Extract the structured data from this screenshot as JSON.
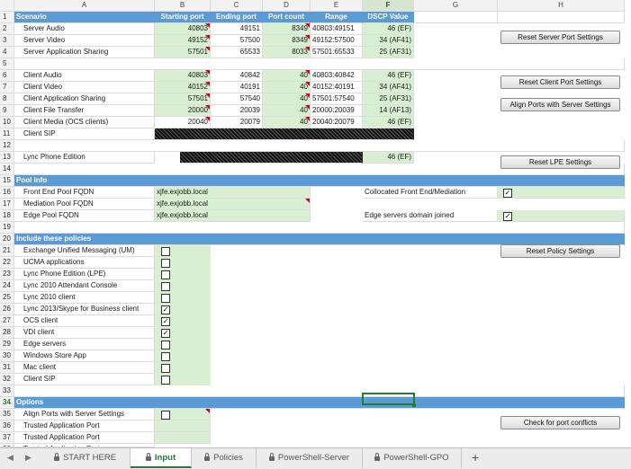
{
  "columns": [
    "A",
    "B",
    "C",
    "D",
    "E",
    "F",
    "G",
    "H"
  ],
  "sheet_headers": {
    "scenario": "Scenario",
    "starting_port": "Starting port",
    "ending_port": "Ending port",
    "port_count": "Port count",
    "range": "Range",
    "dscp_value": "DSCP Value"
  },
  "rows": {
    "r2": {
      "num": "2",
      "label": "Server Audio",
      "start": "40803",
      "end": "49151",
      "count": "8349",
      "range": "40803:49151",
      "dscp": "46 (EF)"
    },
    "r3": {
      "num": "3",
      "label": "Server Video",
      "start": "49152",
      "end": "57500",
      "count": "8349",
      "range": "49152:57500",
      "dscp": "34 (AF41)"
    },
    "r4": {
      "num": "4",
      "label": "Server Application Sharing",
      "start": "57501",
      "end": "65533",
      "count": "8033",
      "range": "57501:65533",
      "dscp": "25 (AF31)"
    },
    "r6": {
      "num": "6",
      "label": "Client Audio",
      "start": "40803",
      "end": "40842",
      "count": "40",
      "range": "40803:40842",
      "dscp": "46 (EF)"
    },
    "r7": {
      "num": "7",
      "label": "Client Video",
      "start": "40152",
      "end": "40191",
      "count": "40",
      "range": "40152:40191",
      "dscp": "34 (AF41)"
    },
    "r8": {
      "num": "8",
      "label": "Client Application Sharing",
      "start": "57501",
      "end": "57540",
      "count": "40",
      "range": "57501:57540",
      "dscp": "25 (AF31)"
    },
    "r9": {
      "num": "9",
      "label": "Client File Transfer",
      "start": "20000",
      "end": "20039",
      "count": "40",
      "range": "20000:20039",
      "dscp": "14 (AF13)"
    },
    "r10": {
      "num": "10",
      "label": "Client Media (OCS clients)",
      "start": "20040",
      "end": "20079",
      "count": "40",
      "range": "20040:20079",
      "dscp": "46 (EF)"
    },
    "r11": {
      "num": "11",
      "label": "Client SIP"
    },
    "r13": {
      "num": "13",
      "label": "Lync Phone Edition",
      "dscp": "46 (EF)"
    }
  },
  "row_numbers": {
    "r1": "1",
    "r5": "5",
    "r12": "12",
    "r14": "14",
    "r15": "15",
    "r16": "16",
    "r17": "17",
    "r18": "18",
    "r19": "19",
    "r20": "20",
    "r21": "21",
    "r22": "22",
    "r23": "23",
    "r24": "24",
    "r25": "25",
    "r26": "26",
    "r27": "27",
    "r28": "28",
    "r29": "29",
    "r30": "30",
    "r31": "31",
    "r32": "32",
    "r33": "33",
    "r34": "34",
    "r35": "35",
    "r36": "36",
    "r37": "37",
    "r38": "38"
  },
  "pool_info": {
    "section": "Pool info",
    "front_end_label": "Front End Pool FQDN",
    "front_end_value": "xjfe.exjobb.local",
    "mediation_label": "Mediation Pool FQDN",
    "mediation_value": "xjfe.exjobb.local",
    "edge_label": "Edge Pool FQDN",
    "edge_value": "xjfe.exjobb.local",
    "collocated_label": "Collocated Front End/Mediation",
    "collocated_checked": "✓",
    "edge_domain_label": "Edge servers domain joined",
    "edge_domain_checked": "✓"
  },
  "policies": {
    "section": "Include these policies",
    "items": [
      {
        "label": "Exchange Unified Messaging (UM)",
        "mark": ""
      },
      {
        "label": "UCMA applications",
        "mark": ""
      },
      {
        "label": "Lync Phone Edition (LPE)",
        "mark": ""
      },
      {
        "label": "Lync 2010 Attendant Console",
        "mark": ""
      },
      {
        "label": "Lync 2010 client",
        "mark": ""
      },
      {
        "label": "Lync 2013/Skype for Business client",
        "mark": "✓"
      },
      {
        "label": "OCS client",
        "mark": "✓"
      },
      {
        "label": "VDI client",
        "mark": "✓"
      },
      {
        "label": "Edge servers",
        "mark": ""
      },
      {
        "label": "Windows Store App",
        "mark": ""
      },
      {
        "label": "Mac client",
        "mark": ""
      },
      {
        "label": "Client SIP",
        "mark": ""
      }
    ]
  },
  "options": {
    "section": "Options",
    "items": [
      "Align Ports with Server Settings",
      "Trusted Application Port",
      "Trusted Application Port",
      "Trusted Application Port"
    ]
  },
  "buttons": {
    "reset_server": "Reset Server Port Settings",
    "reset_client": "Reset Client Port Settings",
    "align_ports": "Align Ports with Server Settings",
    "reset_lpe": "Reset LPE Settings",
    "reset_policy": "Reset Policy Settings",
    "check_conflicts": "Check for port conflicts"
  },
  "tabs": {
    "start_here": "START HERE",
    "input": "Input",
    "policies": "Policies",
    "ps_server": "PowerShell-Server",
    "ps_gpo": "PowerShell-GPO",
    "add": "+"
  },
  "colors": {
    "accent": "#5b9bd5",
    "input_fill": "#d8efd2",
    "selection": "#1e7e34",
    "comment_flag": "#d0021b"
  }
}
